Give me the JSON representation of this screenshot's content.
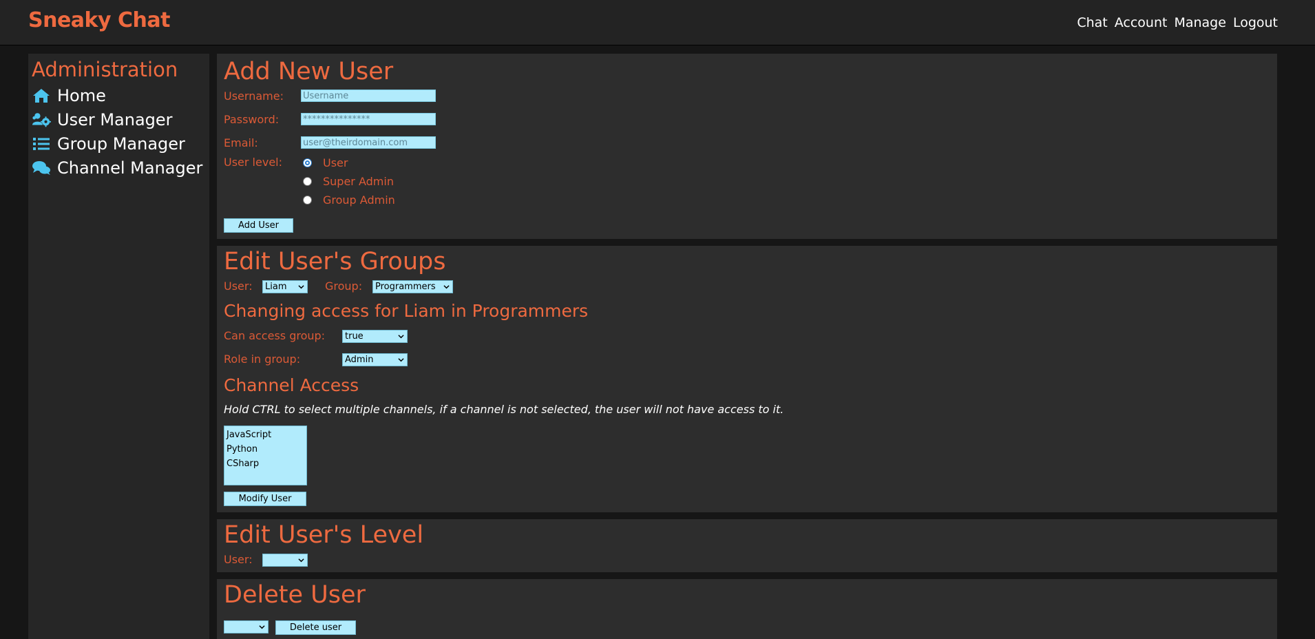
{
  "app": {
    "brand": "Sneaky Chat",
    "nav": [
      "Chat",
      "Account",
      "Manage",
      "Logout"
    ]
  },
  "sidebar": {
    "title": "Administration",
    "items": [
      {
        "label": "Home",
        "icon": "home-icon"
      },
      {
        "label": "User Manager",
        "icon": "users-cog-icon"
      },
      {
        "label": "Group Manager",
        "icon": "list-icon"
      },
      {
        "label": "Channel Manager",
        "icon": "comments-icon"
      }
    ]
  },
  "add_user": {
    "title": "Add New User",
    "username_label": "Username:",
    "username_placeholder": "Username",
    "password_label": "Password:",
    "password_placeholder": "***************",
    "email_label": "Email:",
    "email_placeholder": "user@theirdomain.com",
    "level_label": "User level:",
    "levels": [
      {
        "label": "User",
        "checked": true
      },
      {
        "label": "Super Admin",
        "checked": false
      },
      {
        "label": "Group Admin",
        "checked": false
      }
    ],
    "button": "Add User"
  },
  "edit_groups": {
    "title": "Edit User's Groups",
    "user_label": "User:",
    "user_value": "Liam",
    "group_label": "Group:",
    "group_value": "Programmers",
    "subtitle": "Changing access for Liam in Programmers",
    "access_label": "Can access group:",
    "access_value": "true",
    "role_label": "Role in group:",
    "role_value": "Admin",
    "channel_title": "Channel Access",
    "channel_note": "Hold CTRL to select multiple channels, if a channel is not selected, the user will not have access to it.",
    "channels": [
      "JavaScript",
      "Python",
      "CSharp"
    ],
    "button": "Modify User"
  },
  "edit_level": {
    "title": "Edit User's Level",
    "user_label": "User:",
    "user_value": ""
  },
  "delete_user": {
    "title": "Delete User",
    "select_value": "",
    "button": "Delete user"
  },
  "colors": {
    "accent": "#ee6a40",
    "field_bg": "#b1ebfc",
    "icon": "#4cc4ee"
  }
}
